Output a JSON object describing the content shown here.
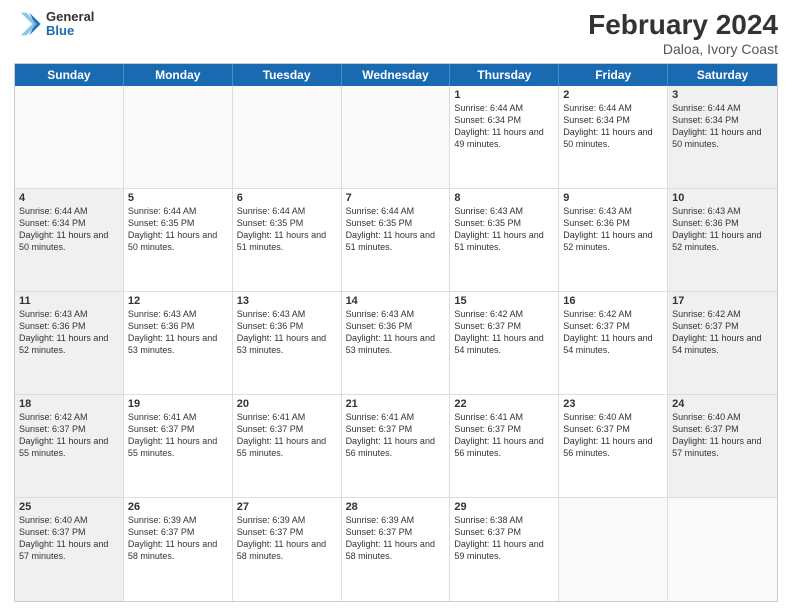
{
  "header": {
    "logo": {
      "general": "General",
      "blue": "Blue"
    },
    "title": "February 2024",
    "subtitle": "Daloa, Ivory Coast"
  },
  "weekdays": [
    "Sunday",
    "Monday",
    "Tuesday",
    "Wednesday",
    "Thursday",
    "Friday",
    "Saturday"
  ],
  "rows": [
    [
      {
        "day": "",
        "info": "",
        "empty": true
      },
      {
        "day": "",
        "info": "",
        "empty": true
      },
      {
        "day": "",
        "info": "",
        "empty": true
      },
      {
        "day": "",
        "info": "",
        "empty": true
      },
      {
        "day": "1",
        "info": "Sunrise: 6:44 AM\nSunset: 6:34 PM\nDaylight: 11 hours\nand 49 minutes."
      },
      {
        "day": "2",
        "info": "Sunrise: 6:44 AM\nSunset: 6:34 PM\nDaylight: 11 hours\nand 50 minutes."
      },
      {
        "day": "3",
        "info": "Sunrise: 6:44 AM\nSunset: 6:34 PM\nDaylight: 11 hours\nand 50 minutes."
      }
    ],
    [
      {
        "day": "4",
        "info": "Sunrise: 6:44 AM\nSunset: 6:34 PM\nDaylight: 11 hours\nand 50 minutes."
      },
      {
        "day": "5",
        "info": "Sunrise: 6:44 AM\nSunset: 6:35 PM\nDaylight: 11 hours\nand 50 minutes."
      },
      {
        "day": "6",
        "info": "Sunrise: 6:44 AM\nSunset: 6:35 PM\nDaylight: 11 hours\nand 51 minutes."
      },
      {
        "day": "7",
        "info": "Sunrise: 6:44 AM\nSunset: 6:35 PM\nDaylight: 11 hours\nand 51 minutes."
      },
      {
        "day": "8",
        "info": "Sunrise: 6:43 AM\nSunset: 6:35 PM\nDaylight: 11 hours\nand 51 minutes."
      },
      {
        "day": "9",
        "info": "Sunrise: 6:43 AM\nSunset: 6:36 PM\nDaylight: 11 hours\nand 52 minutes."
      },
      {
        "day": "10",
        "info": "Sunrise: 6:43 AM\nSunset: 6:36 PM\nDaylight: 11 hours\nand 52 minutes."
      }
    ],
    [
      {
        "day": "11",
        "info": "Sunrise: 6:43 AM\nSunset: 6:36 PM\nDaylight: 11 hours\nand 52 minutes."
      },
      {
        "day": "12",
        "info": "Sunrise: 6:43 AM\nSunset: 6:36 PM\nDaylight: 11 hours\nand 53 minutes."
      },
      {
        "day": "13",
        "info": "Sunrise: 6:43 AM\nSunset: 6:36 PM\nDaylight: 11 hours\nand 53 minutes."
      },
      {
        "day": "14",
        "info": "Sunrise: 6:43 AM\nSunset: 6:36 PM\nDaylight: 11 hours\nand 53 minutes."
      },
      {
        "day": "15",
        "info": "Sunrise: 6:42 AM\nSunset: 6:37 PM\nDaylight: 11 hours\nand 54 minutes."
      },
      {
        "day": "16",
        "info": "Sunrise: 6:42 AM\nSunset: 6:37 PM\nDaylight: 11 hours\nand 54 minutes."
      },
      {
        "day": "17",
        "info": "Sunrise: 6:42 AM\nSunset: 6:37 PM\nDaylight: 11 hours\nand 54 minutes."
      }
    ],
    [
      {
        "day": "18",
        "info": "Sunrise: 6:42 AM\nSunset: 6:37 PM\nDaylight: 11 hours\nand 55 minutes."
      },
      {
        "day": "19",
        "info": "Sunrise: 6:41 AM\nSunset: 6:37 PM\nDaylight: 11 hours\nand 55 minutes."
      },
      {
        "day": "20",
        "info": "Sunrise: 6:41 AM\nSunset: 6:37 PM\nDaylight: 11 hours\nand 55 minutes."
      },
      {
        "day": "21",
        "info": "Sunrise: 6:41 AM\nSunset: 6:37 PM\nDaylight: 11 hours\nand 56 minutes."
      },
      {
        "day": "22",
        "info": "Sunrise: 6:41 AM\nSunset: 6:37 PM\nDaylight: 11 hours\nand 56 minutes."
      },
      {
        "day": "23",
        "info": "Sunrise: 6:40 AM\nSunset: 6:37 PM\nDaylight: 11 hours\nand 56 minutes."
      },
      {
        "day": "24",
        "info": "Sunrise: 6:40 AM\nSunset: 6:37 PM\nDaylight: 11 hours\nand 57 minutes."
      }
    ],
    [
      {
        "day": "25",
        "info": "Sunrise: 6:40 AM\nSunset: 6:37 PM\nDaylight: 11 hours\nand 57 minutes."
      },
      {
        "day": "26",
        "info": "Sunrise: 6:39 AM\nSunset: 6:37 PM\nDaylight: 11 hours\nand 58 minutes."
      },
      {
        "day": "27",
        "info": "Sunrise: 6:39 AM\nSunset: 6:37 PM\nDaylight: 11 hours\nand 58 minutes."
      },
      {
        "day": "28",
        "info": "Sunrise: 6:39 AM\nSunset: 6:37 PM\nDaylight: 11 hours\nand 58 minutes."
      },
      {
        "day": "29",
        "info": "Sunrise: 6:38 AM\nSunset: 6:37 PM\nDaylight: 11 hours\nand 59 minutes."
      },
      {
        "day": "",
        "info": "",
        "empty": true
      },
      {
        "day": "",
        "info": "",
        "empty": true
      }
    ]
  ]
}
